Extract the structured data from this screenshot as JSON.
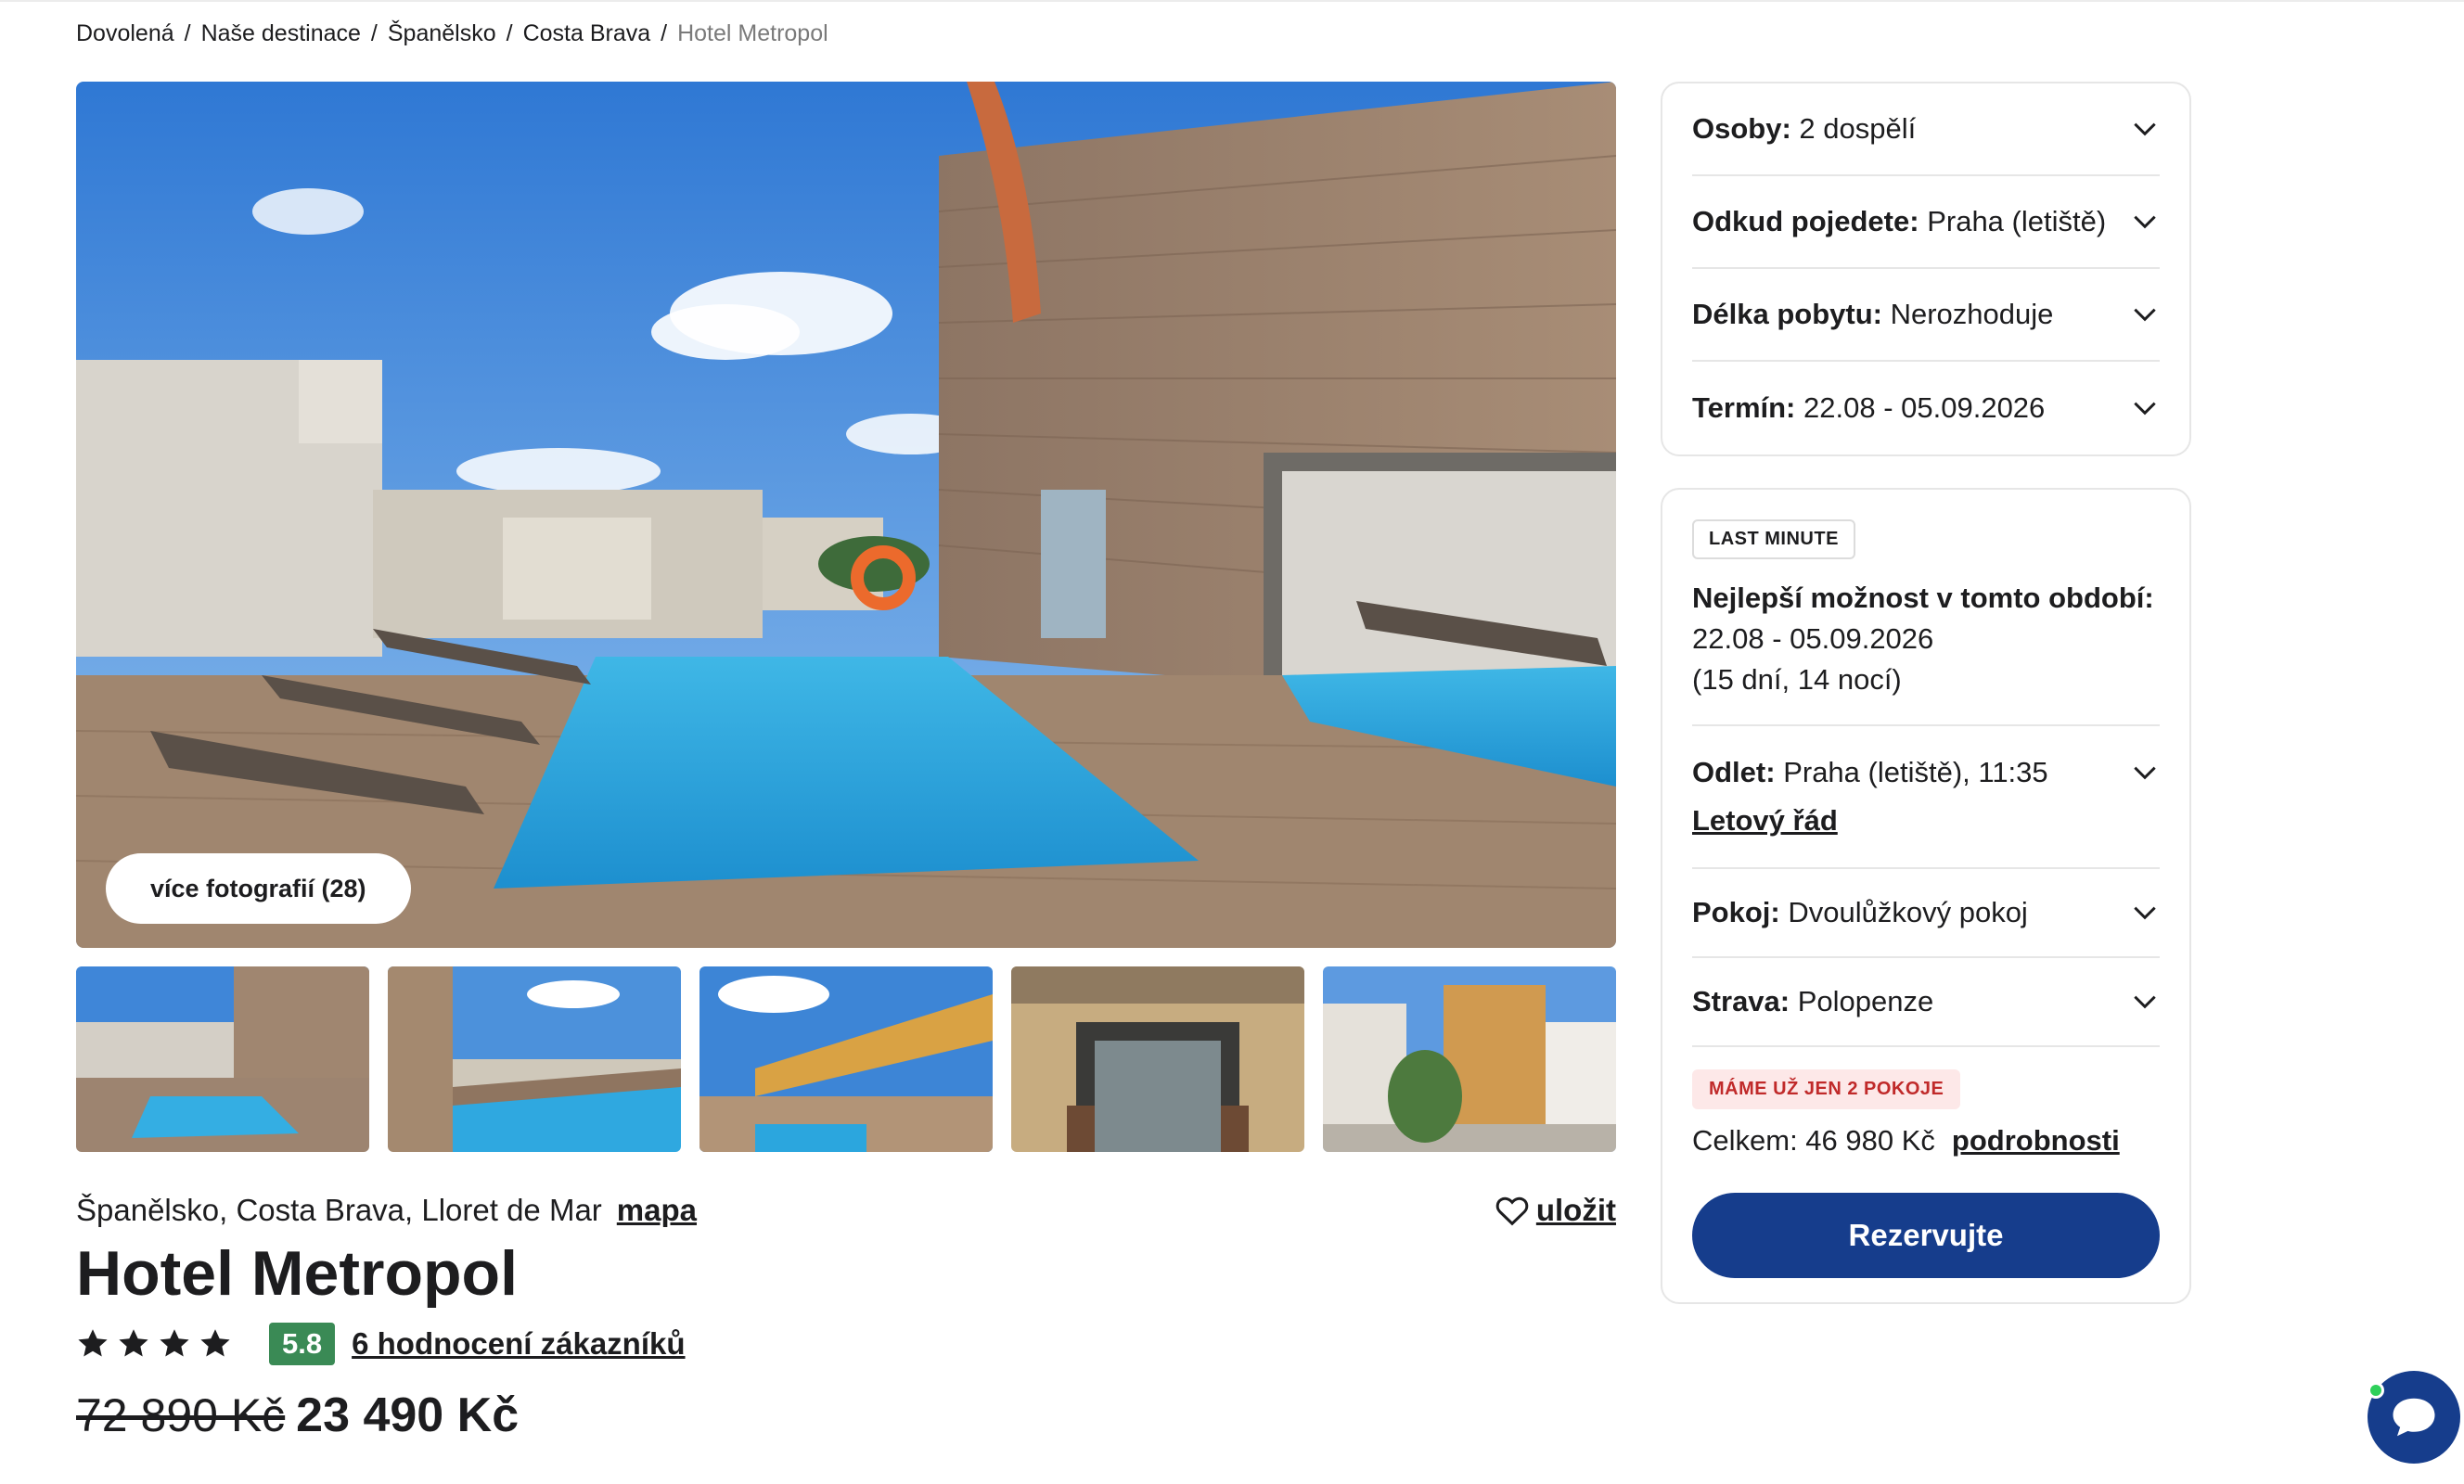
{
  "breadcrumb": {
    "items": [
      "Dovolená",
      "Naše destinace",
      "Španělsko",
      "Costa Brava"
    ],
    "separator": "/",
    "current": "Hotel Metropol"
  },
  "gallery": {
    "more_photos_label": "více fotografií (28)",
    "thumbnails": [
      "pool-deck",
      "pool-sea-view",
      "rooftop-sign",
      "hotel-entrance",
      "street-facade"
    ]
  },
  "hotel": {
    "location": "Španělsko, Costa Brava, Lloret de Mar",
    "map_label": "mapa",
    "save_label": "uložit",
    "name": "Hotel Metropol",
    "stars": 4,
    "score": "5.8",
    "reviews_label": "6 hodnocení zákazníků",
    "price_old": "72 890 Kč",
    "price_new": "23 490 Kč"
  },
  "filters": [
    {
      "label": "Osoby:",
      "value": "2 dospělí"
    },
    {
      "label": "Odkud pojedete:",
      "value": "Praha (letiště)"
    },
    {
      "label": "Délka pobytu:",
      "value": "Nerozhoduje"
    },
    {
      "label": "Termín:",
      "value": "22.08 - 05.09.2026"
    }
  ],
  "offer": {
    "badge": "LAST MINUTE",
    "best_label": "Nejlepší možnost v tomto období:",
    "best_dates": "22.08 - 05.09.2026",
    "best_length": "(15 dní, 14 nocí)",
    "flight_label": "Odlet:",
    "flight_value": "Praha (letiště), 11:35",
    "timetable_label": "Letový řád",
    "room_label": "Pokoj:",
    "room_value": "Dvoulůžkový pokoj",
    "board_label": "Strava:",
    "board_value": "Polopenze",
    "alert": "MÁME UŽ JEN 2 POKOJE",
    "total_label": "Celkem: 46 980 Kč",
    "details_label": "podrobnosti",
    "reserve_label": "Rezervujte"
  },
  "colors": {
    "primary": "#163d8c",
    "score": "#3a8a55",
    "alert_bg": "#fde8e8",
    "alert_text": "#c02a2a",
    "online": "#2ed05a"
  }
}
